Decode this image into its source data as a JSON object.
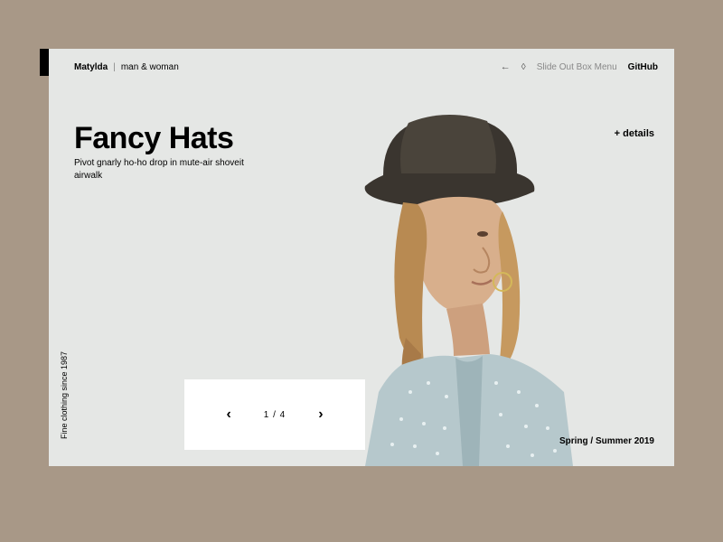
{
  "header": {
    "brand": "Matylda",
    "brand_tag": "man & woman",
    "nav_back": "←",
    "nav_menu": "Slide Out Box Menu",
    "nav_github": "GitHub"
  },
  "hero": {
    "title": "Fancy Hats",
    "subtitle": "Pivot gnarly ho-ho drop in mute-air shoveit airwalk",
    "details": "+ details"
  },
  "pager": {
    "prev": "‹",
    "count": "1 / 4",
    "next": "›"
  },
  "footer": {
    "tagline": "Fine clothing since 1987",
    "season": "Spring / Summer 2019"
  }
}
